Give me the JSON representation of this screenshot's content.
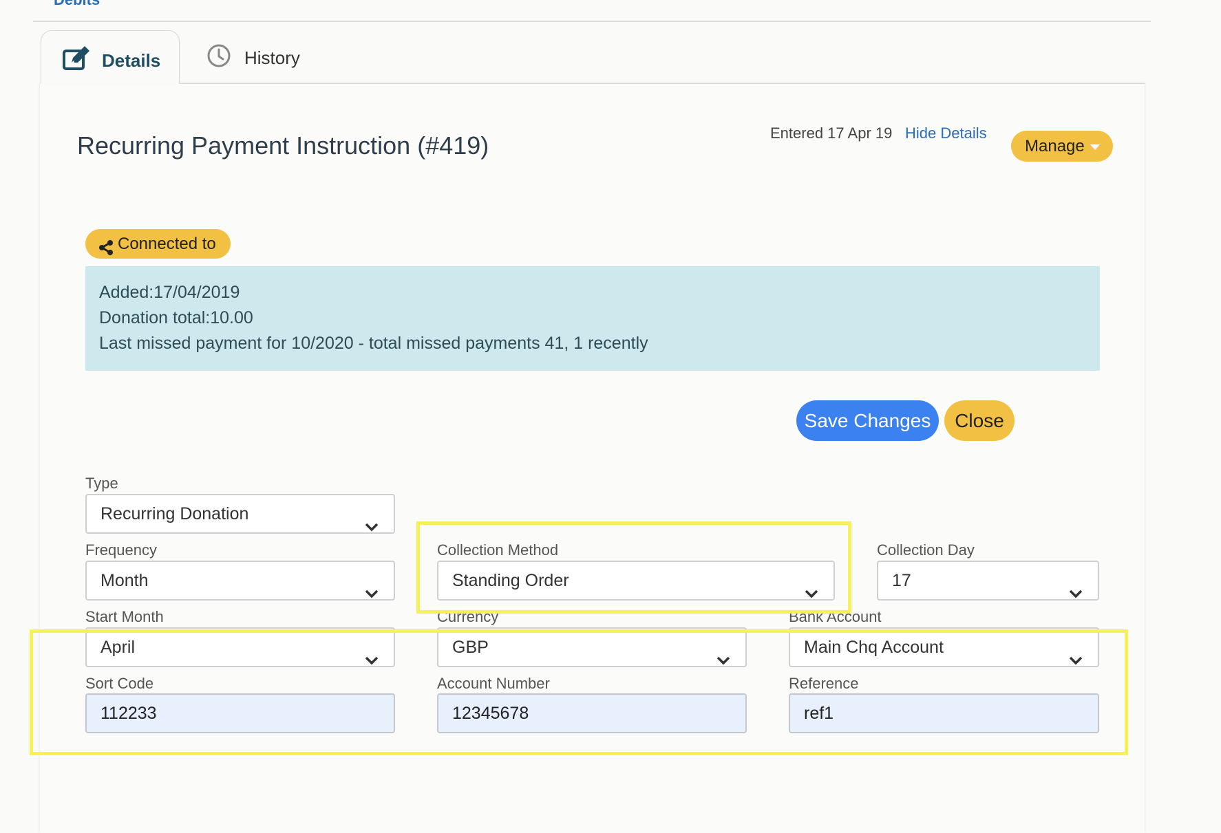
{
  "header": {
    "breadcrumb": "Debits"
  },
  "tabs": [
    {
      "label": "Details",
      "icon": "edit-icon",
      "active": true
    },
    {
      "label": "History",
      "icon": "clock-icon",
      "active": false
    }
  ],
  "record": {
    "title": "Recurring Payment Instruction (#419)",
    "entered": "Entered 17 Apr 19",
    "hide_details": "Hide Details",
    "manage_label": "Manage"
  },
  "connected": {
    "label": "Connected to",
    "icon": "share-icon"
  },
  "info": {
    "added": "Added:17/04/2019",
    "donation_total": "Donation total:10.00",
    "missed": "Last missed payment for 10/2020 - total missed payments 41, 1 recently"
  },
  "actions": {
    "save": "Save Changes",
    "close": "Close"
  },
  "form": {
    "type": {
      "label": "Type",
      "value": "Recurring Donation"
    },
    "frequency": {
      "label": "Frequency",
      "value": "Month"
    },
    "collection_method": {
      "label": "Collection Method",
      "value": "Standing Order"
    },
    "collection_day": {
      "label": "Collection Day",
      "value": "17"
    },
    "start_month": {
      "label": "Start Month",
      "value": "April"
    },
    "currency": {
      "label": "Currency",
      "value": "GBP"
    },
    "bank_account": {
      "label": "Bank Account",
      "value": "Main Chq Account"
    },
    "sort_code": {
      "label": "Sort Code",
      "value": "112233"
    },
    "account_number": {
      "label": "Account Number",
      "value": "12345678"
    },
    "reference": {
      "label": "Reference",
      "value": "ref1"
    }
  },
  "colors": {
    "accent_yellow": "#f2c043",
    "primary_blue": "#3b82f0",
    "info_bg": "#cde9ee",
    "highlight": "#f7f159",
    "autofill_bg": "#e8f0fe"
  }
}
